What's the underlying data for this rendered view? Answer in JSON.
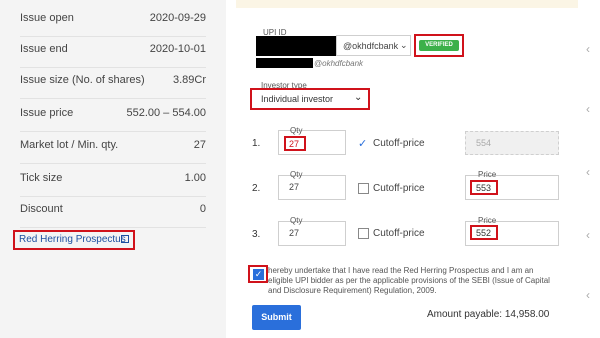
{
  "details": {
    "rows": [
      {
        "label": "Issue open",
        "value": "2020-09-29"
      },
      {
        "label": "Issue end",
        "value": "2020-10-01"
      },
      {
        "label": "Issue size (No. of shares)",
        "value": "3.89Cr"
      },
      {
        "label": "Issue price",
        "value": "552.00 – 554.00"
      },
      {
        "label": "Market lot / Min. qty.",
        "value": "27"
      },
      {
        "label": "Tick size",
        "value": "1.00"
      },
      {
        "label": "Discount",
        "value": "0"
      }
    ],
    "rhp_link": "Red Herring Prospectus"
  },
  "upi": {
    "label": "UPI ID",
    "handle": "@okhdfcbank",
    "verified": "VERIFIED",
    "below_text": "@okhdfcbank"
  },
  "investor": {
    "label": "Investor type",
    "value": "Individual investor"
  },
  "bids": [
    {
      "no": "1.",
      "qty_label": "Qty",
      "qty": "27",
      "cutoff": "Cutoff-price",
      "cutoff_checked": true,
      "price_label": "",
      "price": "554"
    },
    {
      "no": "2.",
      "qty_label": "Qty",
      "qty": "27",
      "cutoff": "Cutoff-price",
      "cutoff_checked": false,
      "price_label": "Price",
      "price": "553"
    },
    {
      "no": "3.",
      "qty_label": "Qty",
      "qty": "27",
      "cutoff": "Cutoff-price",
      "cutoff_checked": false,
      "price_label": "Price",
      "price": "552"
    }
  ],
  "consent": {
    "line1": "hereby undertake that I have read the Red Herring Prospectus and I am an",
    "line2": "eligible UPI bidder as per the applicable provisions of the SEBI (Issue of Capital",
    "line3": "and Disclosure Requirement) Regulation, 2009."
  },
  "footer": {
    "submit": "Submit",
    "amount_label": "Amount payable:",
    "amount_value": "14,958.00"
  },
  "colors": {
    "accent": "#2a6fdb",
    "highlight": "#d0121b",
    "verified": "#3cb04a"
  }
}
